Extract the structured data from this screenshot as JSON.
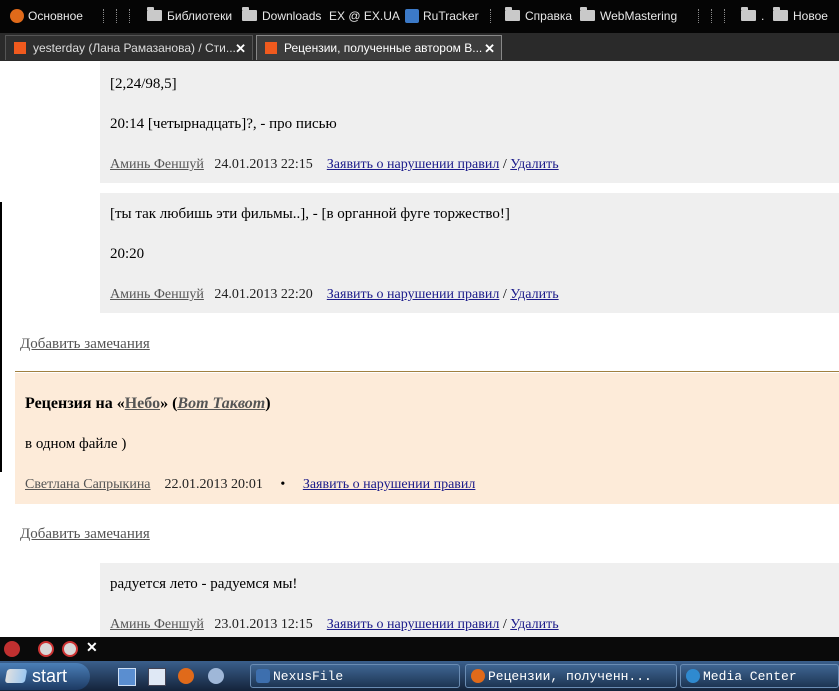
{
  "bookmarks": [
    {
      "label": "Основное",
      "icon": "firefox-icon"
    },
    {
      "label": "Библиотеки",
      "icon": "folder-icon"
    },
    {
      "label": "Downloads",
      "icon": "folder-icon"
    },
    {
      "label": "EX @ EX.UA",
      "icon": "exua-icon"
    },
    {
      "label": "RuTracker",
      "icon": "rutracker-icon"
    },
    {
      "label": "Справка",
      "icon": "folder-icon"
    },
    {
      "label": "WebMastering",
      "icon": "folder-icon"
    },
    {
      "label": ".",
      "icon": "folder-icon"
    },
    {
      "label": "Новое",
      "icon": "folder-icon"
    }
  ],
  "tabs": [
    {
      "title": "yesterday (Лана Рамазанова) / Сти...",
      "active": false
    },
    {
      "title": "Рецензии, полученные автором В...",
      "active": true
    }
  ],
  "comments": [
    {
      "lines": [
        "[2,24/98,5]",
        "20:14 [четырнадцать]?, - про писью"
      ],
      "author": "Аминь Феншуй",
      "date": "24.01.2013 22:15",
      "report": "Заявить о нарушении правил",
      "delete": "Удалить"
    },
    {
      "lines": [
        "[ты так любишь эти фильмы..], - [в органной фуге торжество!]",
        "20:20"
      ],
      "author": "Аминь Феншуй",
      "date": "24.01.2013 22:20",
      "report": "Заявить о нарушении правил",
      "delete": "Удалить"
    }
  ],
  "add_note_1": "Добавить замечания",
  "review": {
    "prefix": "Рецензия на «",
    "work": "Небо",
    "middle": "» (",
    "work_author": "Вот Таквот",
    "suffix": ")",
    "text": "в одном файле )",
    "author": "Светлана Сапрыкина",
    "date": "22.01.2013 20:01",
    "bullet": "•",
    "report": "Заявить о нарушении правил"
  },
  "add_note_2": "Добавить замечания",
  "comment3": {
    "line": "радуется лето - радуемся мы!",
    "author": "Аминь Феншуй",
    "date": "23.01.2013 12:15",
    "report": "Заявить о нарушении правил",
    "delete": "Удалить"
  },
  "meta_separator": "/",
  "taskbar": {
    "start_label": "start",
    "tasks": [
      "NexusFile",
      "Рецензии, полученн...",
      "Media Center"
    ]
  },
  "colors": {
    "review_bg": "#fdebd9",
    "comment_bg": "#efefef",
    "link": "#1a1a8a"
  }
}
